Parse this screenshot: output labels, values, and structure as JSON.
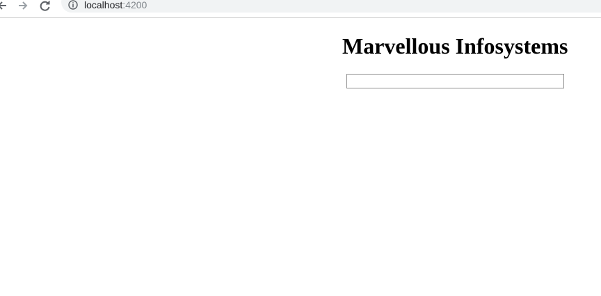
{
  "browser": {
    "url_host": "localhost",
    "url_port": ":4200"
  },
  "app": {
    "title": "Marvellous Infosystems",
    "input": {
      "value": "",
      "placeholder": ""
    }
  },
  "colors": {
    "omnibox_bg": "#f1f3f4",
    "url_text": "#202124",
    "url_port_text": "#80868b",
    "input_border": "#8f8f8f"
  }
}
